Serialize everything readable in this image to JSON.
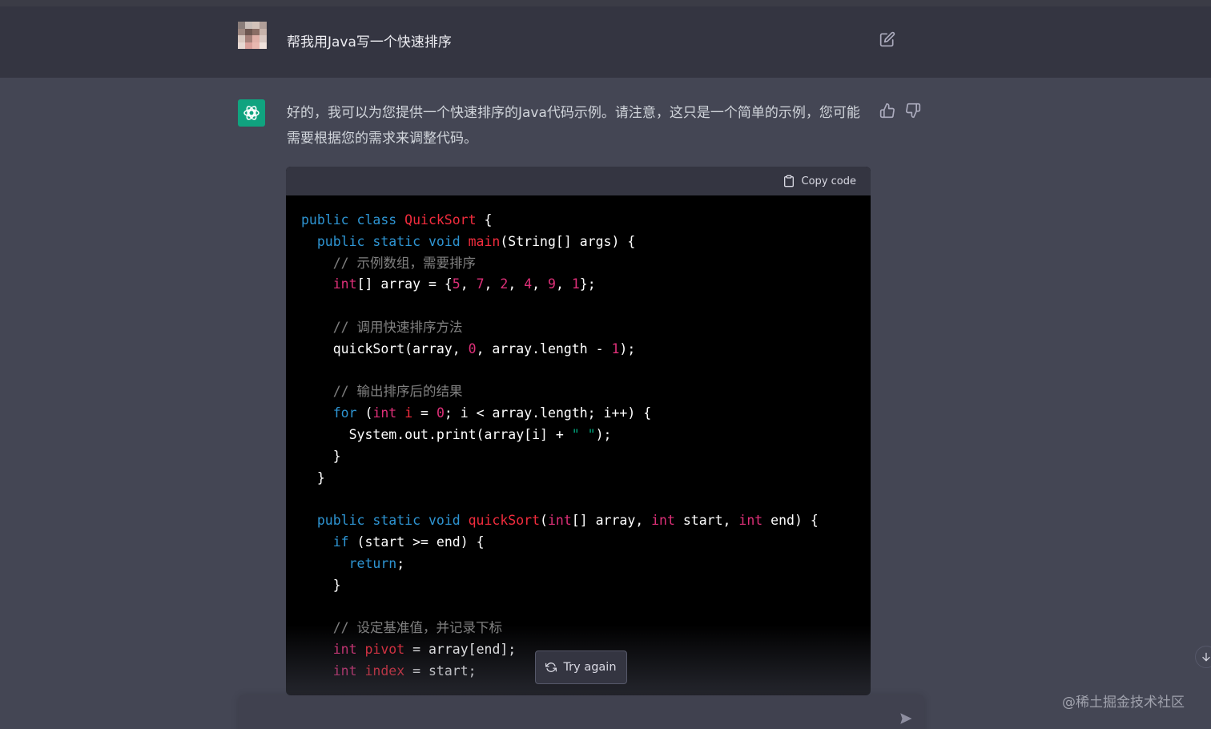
{
  "user_message": {
    "text": "帮我用Java写一个快速排序"
  },
  "assistant_message": {
    "text": "好的，我可以为您提供一个快速排序的Java代码示例。请注意，这只是一个简单的示例，您可能需要根据您的需求来调整代码。"
  },
  "code_block": {
    "copy_label": "Copy code",
    "lines": [
      [
        [
          "kw",
          "public class "
        ],
        [
          "fn",
          "QuickSort"
        ],
        [
          "p",
          " {"
        ]
      ],
      [
        [
          "p",
          "  "
        ],
        [
          "kw",
          "public static void "
        ],
        [
          "fn",
          "main"
        ],
        [
          "p",
          "(String[] args) {"
        ]
      ],
      [
        [
          "cm",
          "    // 示例数组，需要排序"
        ]
      ],
      [
        [
          "p",
          "    "
        ],
        [
          "ty",
          "int"
        ],
        [
          "p",
          "[] array = {"
        ],
        [
          "num",
          "5"
        ],
        [
          "p",
          ", "
        ],
        [
          "num",
          "7"
        ],
        [
          "p",
          ", "
        ],
        [
          "num",
          "2"
        ],
        [
          "p",
          ", "
        ],
        [
          "num",
          "4"
        ],
        [
          "p",
          ", "
        ],
        [
          "num",
          "9"
        ],
        [
          "p",
          ", "
        ],
        [
          "num",
          "1"
        ],
        [
          "p",
          "};"
        ]
      ],
      [
        [
          "p",
          ""
        ]
      ],
      [
        [
          "cm",
          "    // 调用快速排序方法"
        ]
      ],
      [
        [
          "p",
          "    quickSort(array, "
        ],
        [
          "num",
          "0"
        ],
        [
          "p",
          ", array.length - "
        ],
        [
          "num",
          "1"
        ],
        [
          "p",
          ");"
        ]
      ],
      [
        [
          "p",
          ""
        ]
      ],
      [
        [
          "cm",
          "    // 输出排序后的结果"
        ]
      ],
      [
        [
          "p",
          "    "
        ],
        [
          "kw",
          "for"
        ],
        [
          "p",
          " ("
        ],
        [
          "ty",
          "int"
        ],
        [
          "p",
          " "
        ],
        [
          "fn",
          "i"
        ],
        [
          "p",
          " = "
        ],
        [
          "num",
          "0"
        ],
        [
          "p",
          "; i < array.length; i++) {"
        ]
      ],
      [
        [
          "p",
          "      System.out.print(array[i] + "
        ],
        [
          "str",
          "\" \""
        ],
        [
          "p",
          ");"
        ]
      ],
      [
        [
          "p",
          "    }"
        ]
      ],
      [
        [
          "p",
          "  }"
        ]
      ],
      [
        [
          "p",
          ""
        ]
      ],
      [
        [
          "p",
          "  "
        ],
        [
          "kw",
          "public static void "
        ],
        [
          "fn",
          "quickSort"
        ],
        [
          "p",
          "("
        ],
        [
          "ty",
          "int"
        ],
        [
          "p",
          "[] array, "
        ],
        [
          "ty",
          "int"
        ],
        [
          "p",
          " start, "
        ],
        [
          "ty",
          "int"
        ],
        [
          "p",
          " end) {"
        ]
      ],
      [
        [
          "p",
          "    "
        ],
        [
          "kw",
          "if"
        ],
        [
          "p",
          " (start >= end) {"
        ]
      ],
      [
        [
          "p",
          "      "
        ],
        [
          "kw",
          "return"
        ],
        [
          "p",
          ";"
        ]
      ],
      [
        [
          "p",
          "    }"
        ]
      ],
      [
        [
          "p",
          ""
        ]
      ],
      [
        [
          "cm",
          "    // 设定基准值，并记录下标"
        ]
      ],
      [
        [
          "p",
          "    "
        ],
        [
          "ty",
          "int"
        ],
        [
          "p",
          " "
        ],
        [
          "fn",
          "pivot"
        ],
        [
          "p",
          " = array[end];"
        ]
      ],
      [
        [
          "p",
          "    "
        ],
        [
          "ty",
          "int"
        ],
        [
          "p",
          " "
        ],
        [
          "fn",
          "index"
        ],
        [
          "p",
          " = start;"
        ]
      ]
    ]
  },
  "try_again_label": "Try again",
  "watermark": "@稀土掘金技术社区",
  "icons": {
    "edit": "edit-icon",
    "thumb_up": "thumb-up-icon",
    "thumb_down": "thumb-down-icon",
    "copy": "clipboard-icon",
    "refresh": "refresh-icon",
    "send": "send-icon",
    "scroll_down": "arrow-down-icon",
    "assistant_logo": "openai-logo-icon"
  },
  "colors": {
    "user_bg": "#343541",
    "assistant_bg": "#444654",
    "logo_bg": "#10a37f",
    "keyword": "#2e95d3",
    "type": "#df3079",
    "function": "#f22c3d",
    "number": "#df3079",
    "comment": "#808080"
  }
}
